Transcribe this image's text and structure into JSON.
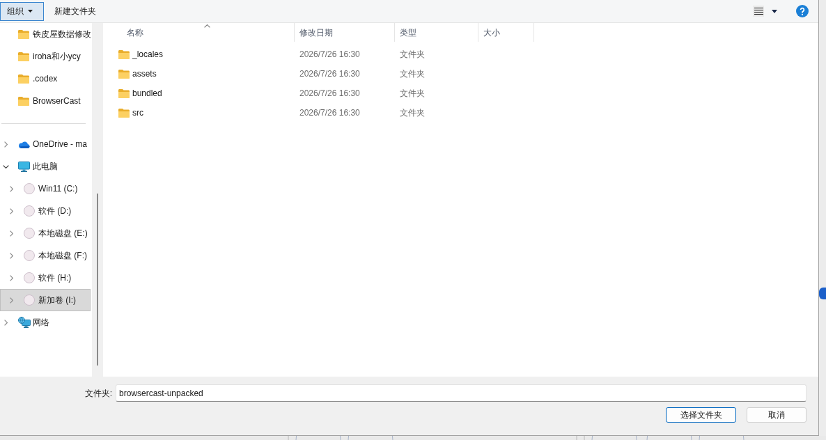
{
  "toolbar": {
    "organize_button": {
      "label": "组织"
    },
    "new_folder_button": {
      "label": "新建文件夹"
    }
  },
  "sidebar": {
    "quick_access": [
      {
        "label": "铁皮屋数据修改"
      },
      {
        "label": "iroha和小ycy"
      },
      {
        "label": ".codex"
      },
      {
        "label": "BrowserCast"
      }
    ],
    "tree": [
      {
        "label": "OneDrive - ma",
        "kind": "cloud",
        "expanded": false,
        "selected": false
      },
      {
        "label": "此电脑",
        "kind": "computer",
        "expanded": true,
        "selected": false,
        "children": [
          {
            "label": "Win11 (C:)",
            "kind": "drive",
            "expanded": false,
            "selected": false
          },
          {
            "label": "软件 (D:)",
            "kind": "drive",
            "expanded": false,
            "selected": false
          },
          {
            "label": "本地磁盘 (E:)",
            "kind": "drive",
            "expanded": false,
            "selected": false
          },
          {
            "label": "本地磁盘 (F:)",
            "kind": "drive",
            "expanded": false,
            "selected": false
          },
          {
            "label": "软件 (H:)",
            "kind": "drive",
            "expanded": false,
            "selected": false
          },
          {
            "label": "新加卷 (I:)",
            "kind": "drive",
            "expanded": false,
            "selected": true
          }
        ]
      },
      {
        "label": "网络",
        "kind": "network",
        "expanded": false,
        "selected": false
      }
    ]
  },
  "file_list": {
    "columns": [
      {
        "label": "名称",
        "sorted": true
      },
      {
        "label": "修改日期",
        "sorted": false
      },
      {
        "label": "类型",
        "sorted": false
      },
      {
        "label": "大小",
        "sorted": false
      }
    ],
    "rows": [
      {
        "name": "_locales",
        "modified": "2026/7/26 16:30",
        "type": "文件夹"
      },
      {
        "name": "assets",
        "modified": "2026/7/26 16:30",
        "type": "文件夹"
      },
      {
        "name": "bundled",
        "modified": "2026/7/26 16:30",
        "type": "文件夹"
      },
      {
        "name": "src",
        "modified": "2026/7/26 16:30",
        "type": "文件夹"
      }
    ]
  },
  "folder_field": {
    "label": "文件夹:",
    "value": "browsercast-unpacked"
  },
  "buttons": [
    {
      "label": "选择文件夹",
      "default": true
    },
    {
      "label": "取消",
      "default": false
    }
  ]
}
